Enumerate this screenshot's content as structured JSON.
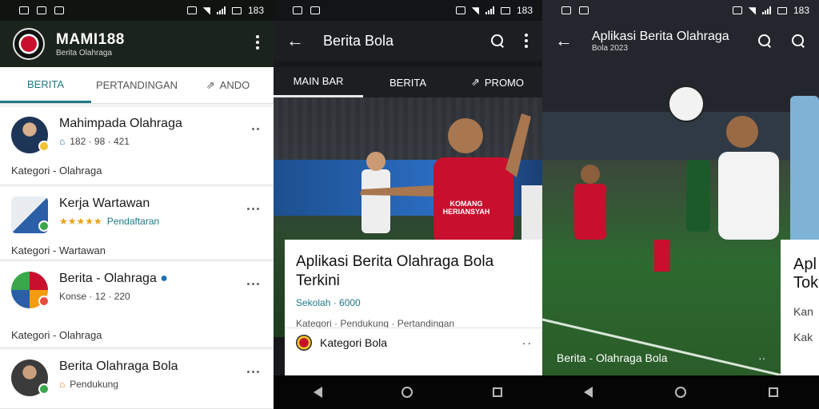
{
  "status": [
    {
      "time": "183"
    },
    {
      "time": "183"
    },
    {
      "time": "183"
    }
  ],
  "panel1": {
    "app_title": "MAMI188",
    "app_subtitle": "Berita Olahraga",
    "tabs": [
      {
        "label": "BERITA"
      },
      {
        "label": "PERTANDINGAN"
      },
      {
        "label": "ANDO"
      }
    ],
    "cards": [
      {
        "name": "Mahimpada Olahraga",
        "meta": "182 · 98 · 421",
        "category": "Kategori - Olahraga"
      },
      {
        "name": "Kerja Wartawan",
        "meta": "Pendaftaran",
        "category": "Kategori - Wartawan"
      },
      {
        "name": "Berita - Olahraga",
        "meta": "Konse · 12 · 220",
        "category": "Kategori - Olahraga"
      },
      {
        "name": "Berita Olahraga Bola",
        "meta": "Pendukung",
        "category": ""
      }
    ],
    "colors": {
      "accent": "#1f7a86",
      "appbar": "#1b241c"
    }
  },
  "panel2": {
    "title": "Berita Bola",
    "tabs": [
      {
        "label": "MAIN BAR"
      },
      {
        "label": "BERITA"
      },
      {
        "label": "PROMO"
      }
    ],
    "card_title": "Aplikasi Berita Olahraga Bola Terkini",
    "card_meta": "Sekolah · 6000",
    "card_category": "Kategori · Pendukung · Pertandingan",
    "footer_title": "Kategori Bola",
    "player_shirt": "KOMANG HERIANSYAH"
  },
  "panel3": {
    "title": "Aplikasi Berita Olahraga",
    "subtitle": "Bola 2023",
    "caption": "Berita - Olahraga Bola",
    "side_title": "Apl",
    "side_sub": "Tok",
    "side_lines": [
      "Kan",
      "Kak"
    ]
  }
}
